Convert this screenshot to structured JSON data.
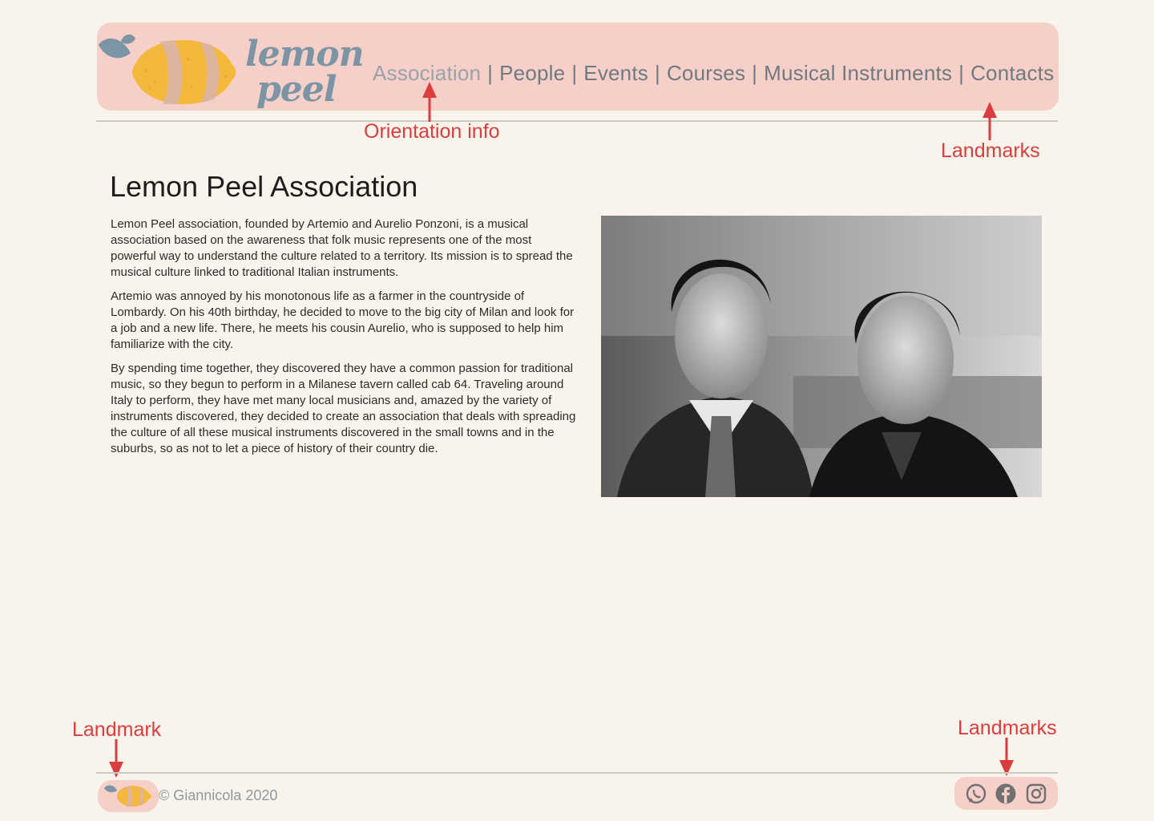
{
  "header": {
    "logo_line1": "lemon",
    "logo_line2": "peel",
    "nav": [
      {
        "label": "Association",
        "active": true
      },
      {
        "label": "People"
      },
      {
        "label": "Events"
      },
      {
        "label": "Courses"
      },
      {
        "label": "Musical Instruments"
      },
      {
        "label": "Contacts"
      }
    ],
    "separator": "|"
  },
  "annotations": {
    "orientation": "Orientation info",
    "landmarks_top": "Landmarks",
    "landmark_footer": "Landmark",
    "landmarks_footer": "Landmarks"
  },
  "main": {
    "title": "Lemon Peel Association",
    "paragraphs": [
      "Lemon Peel association, founded by Artemio and Aurelio Ponzoni, is a musical association based on the awareness that folk music represents one of the most powerful way to understand the culture related to a territory. Its mission is to spread the musical culture linked to traditional Italian instruments.",
      "Artemio was annoyed by his monotonous life as a farmer in the countryside of Lombardy. On his 40th birthday, he decided to move to the big city of Milan and look for a job and a new life. There, he meets his cousin Aurelio, who is supposed to help him familiarize with the city.",
      "By spending time together, they discovered they have a common passion for traditional music, so they begun to perform in a Milanese tavern called cab 64. Traveling around Italy to perform, they have met many local musicians and, amazed by the variety of instruments discovered, they decided to create an association that deals with spreading the culture of all these musical instruments discovered in the small towns and in the suburbs, so as not to let a piece of history of their country die."
    ]
  },
  "footer": {
    "copyright": "© Giannicola 2020",
    "socials": [
      "whatsapp-icon",
      "facebook-icon",
      "instagram-icon"
    ]
  },
  "colors": {
    "background": "#f8f4ec",
    "header_bg": "#f5cfc8",
    "annotation": "#d93d3d",
    "nav_text": "#6f7a80",
    "lemon": "#f4b93a",
    "leaf": "#7b95a4"
  }
}
